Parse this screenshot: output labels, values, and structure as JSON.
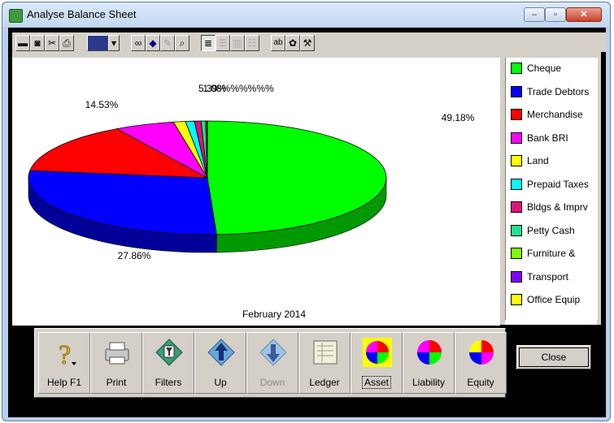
{
  "window": {
    "title": "Analyse Balance Sheet",
    "controls": {
      "minimize": "–",
      "maximize": "▫",
      "close": "✕"
    }
  },
  "toolbar": {
    "icons": [
      "save-icon",
      "camera-icon",
      "cut-icon",
      "print-icon",
      "color-box-icon",
      "dropdown-arrow-icon",
      "binoculars-icon",
      "3d-shape-icon",
      "edit-disabled-icon",
      "preview-icon",
      "doc-icon",
      "doc-lines-icon",
      "columns-icon",
      "list-icon",
      "ab-icon",
      "palette-icon",
      "hammer-icon"
    ]
  },
  "chart_data": {
    "type": "pie",
    "title": "February 2014",
    "slices": [
      {
        "name": "Cheque",
        "value": 49.18,
        "label": "49.18%",
        "color": "#00ff00"
      },
      {
        "name": "Trade Debtors",
        "value": 27.86,
        "label": "27.86%",
        "color": "#0000ff"
      },
      {
        "name": "Merchandise",
        "value": 14.53,
        "label": "14.53%",
        "color": "#ff0000"
      },
      {
        "name": "Bank BRI",
        "value": 5.39,
        "label": "5.39%",
        "color": "#ff00ff"
      },
      {
        "name": "Land",
        "value": 1.08,
        "label": "1.08%",
        "color": "#ffff00"
      },
      {
        "name": "Prepaid Taxes",
        "value": 0.8,
        "label": "",
        "color": "#00ffff"
      },
      {
        "name": "Bldgs & Imprv",
        "value": 0.6,
        "label": "",
        "color": "#e0107a"
      },
      {
        "name": "Petty Cash",
        "value": 0.4,
        "label": "",
        "color": "#20e090"
      },
      {
        "name": "Furniture &",
        "value": 0.1,
        "label": "",
        "color": "#80ff00"
      },
      {
        "name": "Transport",
        "value": 0.06,
        "label": "",
        "color": "#8000ff"
      }
    ],
    "overlap_label": "1.08%%%%%%",
    "legend": [
      "Cheque",
      "Trade Debtors",
      "Merchandise",
      "Bank BRI",
      "Land",
      "Prepaid Taxes",
      "Bldgs & Imprv",
      "Petty Cash",
      "Furniture &",
      "Transport",
      "Office Equip"
    ],
    "legend_colors": [
      "#00ff00",
      "#0000ff",
      "#ff0000",
      "#ff00ff",
      "#ffff00",
      "#00ffff",
      "#e0107a",
      "#20e090",
      "#80ff00",
      "#8000ff",
      "#ffff00"
    ]
  },
  "buttons": [
    {
      "label": "Help F1",
      "icon": "help-question-icon"
    },
    {
      "label": "Print",
      "icon": "printer-icon"
    },
    {
      "label": "Filters",
      "icon": "filter-icon"
    },
    {
      "label": "Up",
      "icon": "up-arrow-icon"
    },
    {
      "label": "Down",
      "icon": "down-arrow-icon",
      "disabled": true
    },
    {
      "label": "Ledger",
      "icon": "ledger-icon"
    },
    {
      "label": "Asset",
      "icon": "asset-pie-icon",
      "selected": true
    },
    {
      "label": "Liability",
      "icon": "liability-pie-icon"
    },
    {
      "label": "Equity",
      "icon": "equity-pie-icon"
    }
  ],
  "close_button": {
    "label": "Close"
  }
}
